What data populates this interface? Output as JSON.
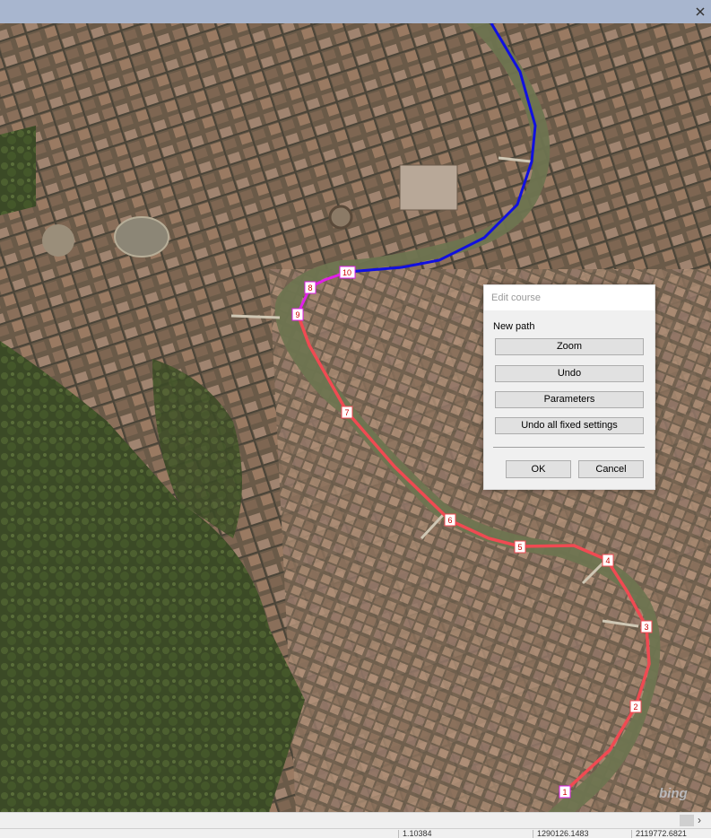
{
  "map": {
    "watermark": "bing",
    "colors": {
      "route_red": "#f04a52",
      "route_magenta": "#e020e8",
      "route_blue": "#1010e0",
      "river": "#6e7450"
    },
    "markers": [
      "1",
      "2",
      "3",
      "4",
      "5",
      "6",
      "7",
      "8",
      "9",
      "10"
    ]
  },
  "dialog": {
    "title": "Edit course",
    "section_label": "New path",
    "buttons": {
      "zoom": "Zoom",
      "undo": "Undo",
      "parameters": "Parameters",
      "undo_all": "Undo all fixed settings"
    },
    "ok": "OK",
    "cancel": "Cancel"
  },
  "status": {
    "cells": [
      "1.10384",
      "1290126.1483",
      "2119772.6821"
    ]
  }
}
